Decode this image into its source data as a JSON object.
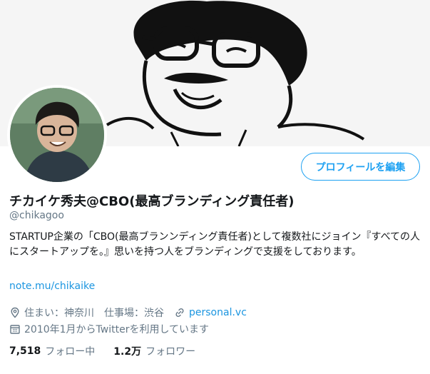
{
  "profile": {
    "display_name": "チカイケ秀夫@CBO(最高ブランディング責任者)",
    "handle": "@chikagoo",
    "edit_button": "プロフィールを編集",
    "bio": "STARTUP企業の「CBO(最高ブランンディング責任者)として複数社にジョイン『すべての人にスタートアップを。』思いを持つ人をブランディングで支援をしております。",
    "bio_link": "note.mu/chikaike",
    "location": "住まい：神奈川　仕事場：渋谷",
    "website": "personal.vc",
    "joined": "2010年1月からTwitterを利用しています"
  },
  "stats": {
    "following_count": "7,518",
    "following_label": "フォロー中",
    "followers_count": "1.2万",
    "followers_label": "フォロワー"
  },
  "colors": {
    "accent": "#1da1f2",
    "link": "#1b95e0",
    "muted": "#657786",
    "text": "#14171a"
  },
  "icons": [
    "location-pin-icon",
    "link-icon",
    "calendar-icon"
  ]
}
